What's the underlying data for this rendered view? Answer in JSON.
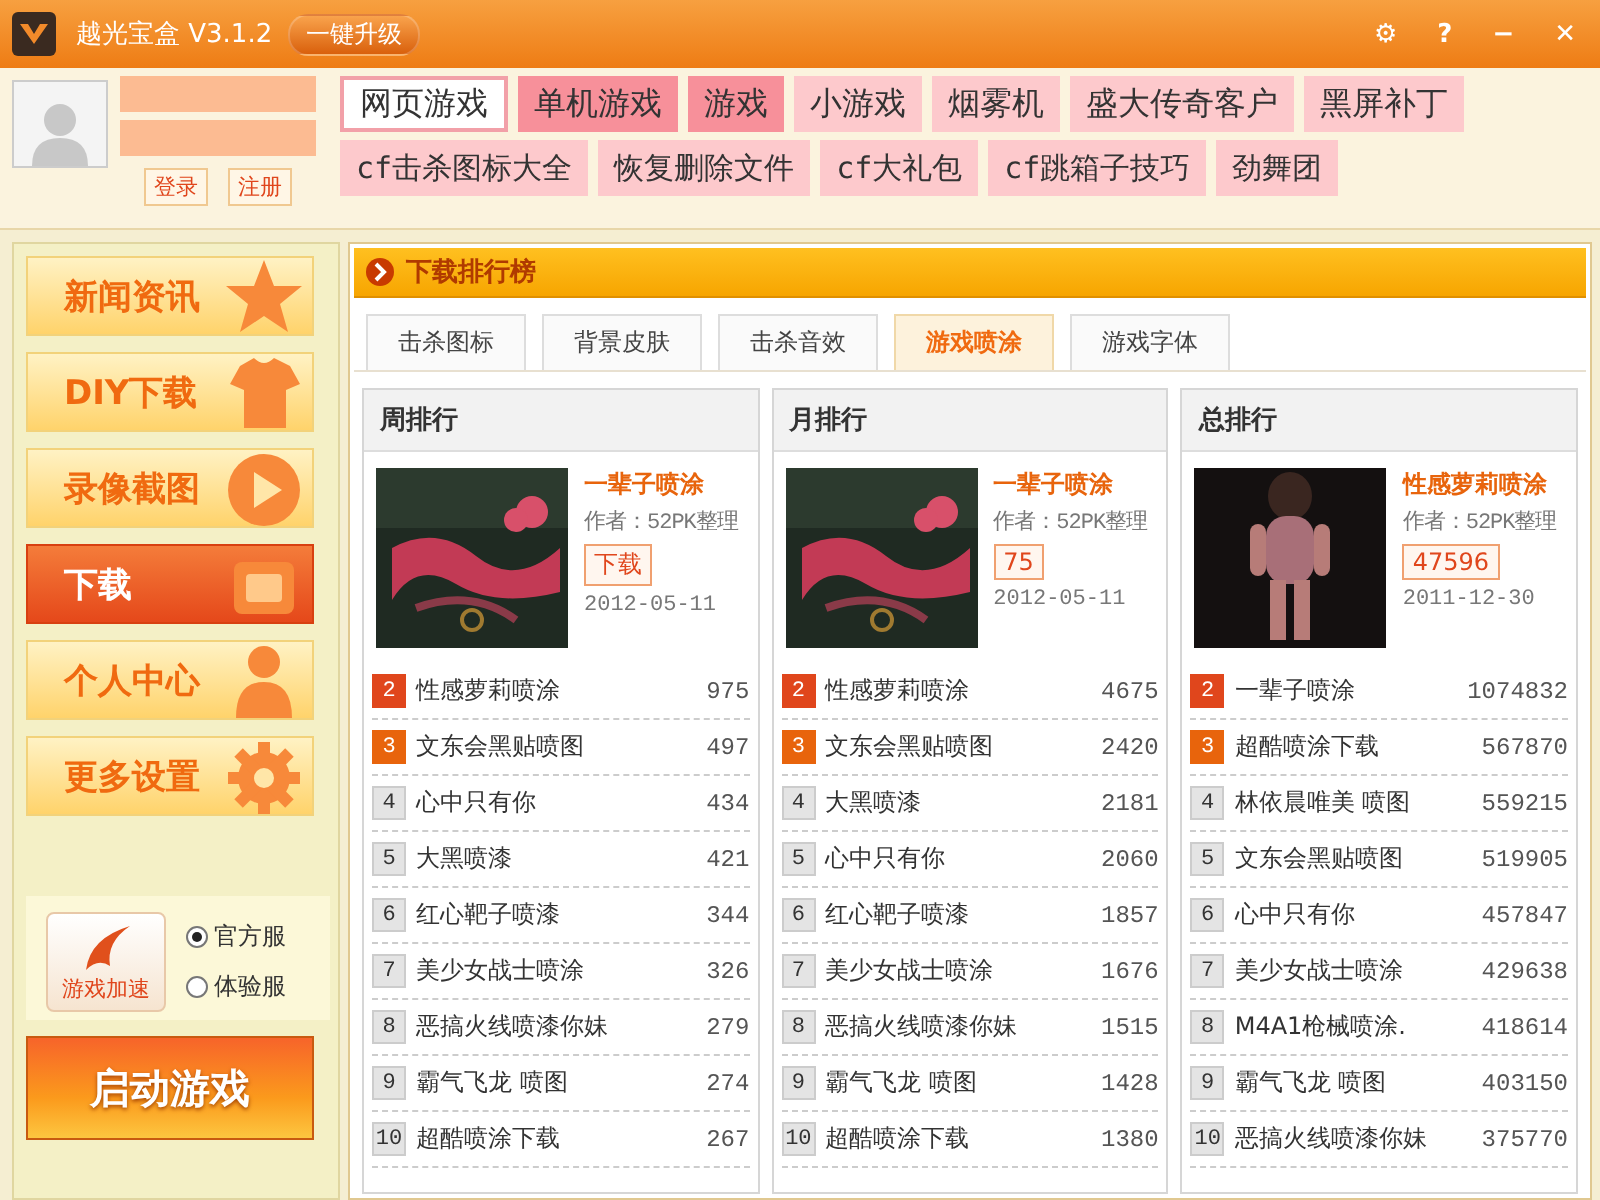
{
  "window": {
    "title": "越光宝盒 V3.1.2",
    "upgrade_button": "一键升级",
    "controls": [
      "⚙",
      "?",
      "−",
      "✕"
    ]
  },
  "login": {
    "buttons": [
      "登录",
      "注册"
    ]
  },
  "tags": [
    [
      {
        "label": "网页游戏",
        "kind": "outline"
      },
      {
        "label": "单机游戏",
        "kind": "hot"
      },
      {
        "label": "游戏",
        "kind": "hot"
      },
      {
        "label": "小游戏",
        "kind": "normal"
      },
      {
        "label": "烟雾机",
        "kind": "normal"
      },
      {
        "label": "盛大传奇客户",
        "kind": "normal"
      },
      {
        "label": "黑屏补丁",
        "kind": "normal"
      }
    ],
    [
      {
        "label": "cf击杀图标大全",
        "kind": "normal"
      },
      {
        "label": "恢复删除文件",
        "kind": "normal"
      },
      {
        "label": "cf大礼包",
        "kind": "normal"
      },
      {
        "label": "cf跳箱子技巧",
        "kind": "normal"
      },
      {
        "label": "劲舞团",
        "kind": "normal"
      }
    ]
  ],
  "sidebar": {
    "items": [
      {
        "label": "新闻资讯",
        "kind": "star",
        "selected": false
      },
      {
        "label": "DIY下载",
        "kind": "shirt",
        "selected": false
      },
      {
        "label": "录像截图",
        "kind": "play",
        "selected": false
      },
      {
        "label": "下载",
        "kind": "box",
        "selected": true
      },
      {
        "label": "个人中心",
        "kind": "person",
        "selected": false
      },
      {
        "label": "更多设置",
        "kind": "gear",
        "selected": false
      }
    ],
    "accelerate_button": "游戏加速",
    "servers": [
      {
        "label": "官方服",
        "selected": true
      },
      {
        "label": "体验服",
        "selected": false
      }
    ],
    "start_button": "启动游戏"
  },
  "section_title": "下载排行榜",
  "tabs": [
    {
      "label": "击杀图标",
      "selected": false
    },
    {
      "label": "背景皮肤",
      "selected": false
    },
    {
      "label": "击杀音效",
      "selected": false
    },
    {
      "label": "游戏喷涂",
      "selected": true
    },
    {
      "label": "游戏字体",
      "selected": false
    }
  ],
  "rankings": [
    {
      "title": "周排行",
      "featured": {
        "kind": "picture",
        "name": "一辈子喷涂",
        "author": "作者：52PK整理",
        "download": "下载",
        "date": "2012-05-11"
      },
      "rows": [
        {
          "rank": "2",
          "name": "性感萝莉喷涂",
          "count": "975",
          "color": "#e0461c"
        },
        {
          "rank": "3",
          "name": "文东会黑贴喷图",
          "count": "497",
          "color": "#e8640c"
        },
        {
          "rank": "4",
          "name": "心中只有你",
          "count": "434",
          "color": "#e4e4e4"
        },
        {
          "rank": "5",
          "name": "大黑喷漆",
          "count": "421",
          "color": "#e4e4e4"
        },
        {
          "rank": "6",
          "name": "红心靶子喷漆",
          "count": "344",
          "color": "#e4e4e4"
        },
        {
          "rank": "7",
          "name": "美少女战士喷涂",
          "count": "326",
          "color": "#e4e4e4"
        },
        {
          "rank": "8",
          "name": "恶搞火线喷漆你妹",
          "count": "279",
          "color": "#e4e4e4"
        },
        {
          "rank": "9",
          "name": "霸气飞龙 喷图",
          "count": "274",
          "color": "#e4e4e4"
        },
        {
          "rank": "10",
          "name": "超酷喷涂下载",
          "count": "267",
          "color": "#e4e4e4"
        }
      ]
    },
    {
      "title": "月排行",
      "featured": {
        "kind": "picture",
        "name": "一辈子喷涂",
        "author": "作者：52PK整理",
        "download": "75",
        "date": "2012-05-11"
      },
      "rows": [
        {
          "rank": "2",
          "name": "性感萝莉喷涂",
          "count": "4675",
          "color": "#e0461c"
        },
        {
          "rank": "3",
          "name": "文东会黑贴喷图",
          "count": "2420",
          "color": "#e8640c"
        },
        {
          "rank": "4",
          "name": "大黑喷漆",
          "count": "2181",
          "color": "#e4e4e4"
        },
        {
          "rank": "5",
          "name": "心中只有你",
          "count": "2060",
          "color": "#e4e4e4"
        },
        {
          "rank": "6",
          "name": "红心靶子喷漆",
          "count": "1857",
          "color": "#e4e4e4"
        },
        {
          "rank": "7",
          "name": "美少女战士喷涂",
          "count": "1676",
          "color": "#e4e4e4"
        },
        {
          "rank": "8",
          "name": "恶搞火线喷漆你妹",
          "count": "1515",
          "color": "#e4e4e4"
        },
        {
          "rank": "9",
          "name": "霸气飞龙 喷图",
          "count": "1428",
          "color": "#e4e4e4"
        },
        {
          "rank": "10",
          "name": "超酷喷涂下载",
          "count": "1380",
          "color": "#e4e4e4"
        }
      ]
    },
    {
      "title": "总排行",
      "featured": {
        "kind": "picture",
        "name": "性感萝莉喷涂",
        "author": "作者：52PK整理",
        "download": "47596",
        "date": "2011-12-30"
      },
      "rows": [
        {
          "rank": "2",
          "name": "一辈子喷涂",
          "count": "1074832",
          "color": "#e0461c"
        },
        {
          "rank": "3",
          "name": "超酷喷涂下载",
          "count": "567870",
          "color": "#e8640c"
        },
        {
          "rank": "4",
          "name": "林依晨唯美 喷图",
          "count": "559215",
          "color": "#e4e4e4"
        },
        {
          "rank": "5",
          "name": "文东会黑贴喷图",
          "count": "519905",
          "color": "#e4e4e4"
        },
        {
          "rank": "6",
          "name": "心中只有你",
          "count": "457847",
          "color": "#e4e4e4"
        },
        {
          "rank": "7",
          "name": "美少女战士喷涂",
          "count": "429638",
          "color": "#e4e4e4"
        },
        {
          "rank": "8",
          "name": "M4A1枪械喷涂.",
          "count": "418614",
          "color": "#e4e4e4"
        },
        {
          "rank": "9",
          "name": "霸气飞龙 喷图",
          "count": "403150",
          "color": "#e4e4e4"
        },
        {
          "rank": "10",
          "name": "恶搞火线喷漆你妹",
          "count": "375770",
          "color": "#e4e4e4"
        }
      ]
    }
  ]
}
